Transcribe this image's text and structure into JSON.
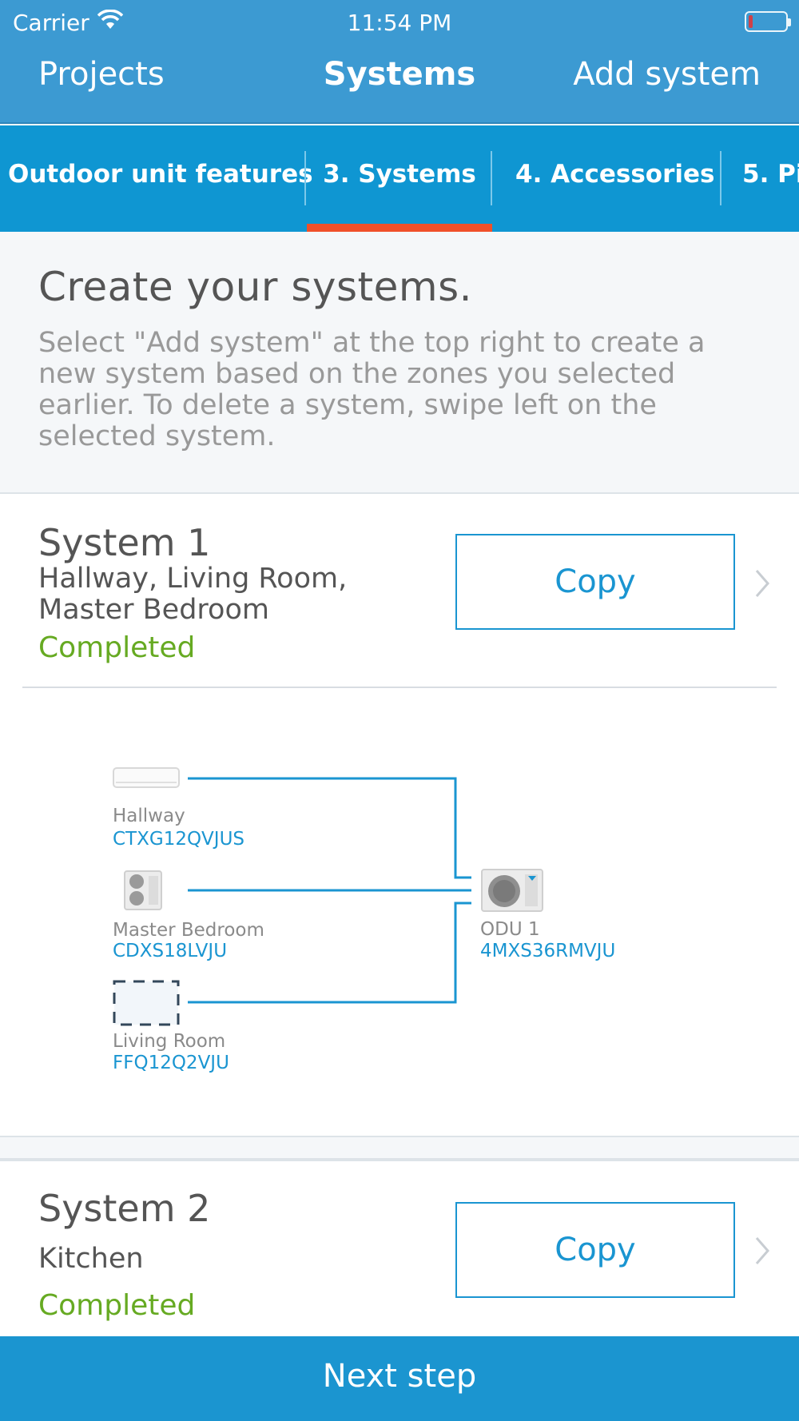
{
  "status_bar": {
    "carrier": "Carrier",
    "time": "11:54 PM"
  },
  "nav": {
    "back_label": "Projects",
    "title": "Systems",
    "action_label": "Add system"
  },
  "steps": [
    {
      "label": "Outdoor unit features",
      "active": false
    },
    {
      "label": "3. Systems",
      "active": true
    },
    {
      "label": "4. Accessories",
      "active": false
    },
    {
      "label": "5. Pi",
      "active": false
    }
  ],
  "intro": {
    "heading": "Create your systems.",
    "body": "Select \"Add system\" at the top right to create a new system based on the zones you selected earlier. To delete a system, swipe left on the selected system."
  },
  "systems": [
    {
      "title": "System 1",
      "zones": "Hallway, Living Room, Master Bedroom",
      "status": "Completed",
      "copy_label": "Copy",
      "diagram": {
        "indoor_units": [
          {
            "room": "Hallway",
            "model": "CTXG12QVJUS",
            "icon": "wall-mounted-unit-icon"
          },
          {
            "room": "Master Bedroom",
            "model": "CDXS18LVJU",
            "icon": "ducted-unit-icon"
          },
          {
            "room": "Living Room",
            "model": "FFQ12Q2VJU",
            "icon": "ceiling-cassette-icon"
          }
        ],
        "outdoor_unit": {
          "name": "ODU 1",
          "model": "4MXS36RMVJU",
          "icon": "outdoor-unit-icon"
        }
      }
    },
    {
      "title": "System 2",
      "zones": "Kitchen",
      "status": "Completed",
      "copy_label": "Copy"
    }
  ],
  "footer": {
    "next_label": "Next step"
  },
  "colors": {
    "header": "#3c9ad2",
    "tabs": "#0f96d2",
    "tab_indicator": "#f0502a",
    "accent": "#1a95d1",
    "completed": "#66aa22"
  }
}
